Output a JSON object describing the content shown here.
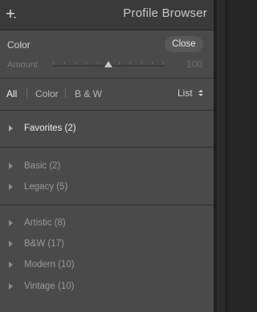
{
  "header": {
    "title": "Profile Browser",
    "add_icon": "plus-icon"
  },
  "color_section": {
    "label": "Color",
    "close_label": "Close",
    "amount_label": "Amount",
    "amount_value": "100",
    "amount_fraction": 0.5
  },
  "filters": {
    "items": [
      "All",
      "Color",
      "B & W"
    ],
    "active": "All",
    "view_label": "List",
    "view_icon": "up-down-arrows-icon"
  },
  "groups": [
    {
      "items": [
        {
          "label": "Favorites (2)"
        }
      ]
    },
    {
      "items": [
        {
          "label": "Basic (2)"
        },
        {
          "label": "Legacy (5)"
        }
      ]
    },
    {
      "items": [
        {
          "label": "Artistic (8)"
        },
        {
          "label": "B&W (17)"
        },
        {
          "label": "Modern (10)"
        },
        {
          "label": "Vintage (10)"
        }
      ]
    }
  ]
}
